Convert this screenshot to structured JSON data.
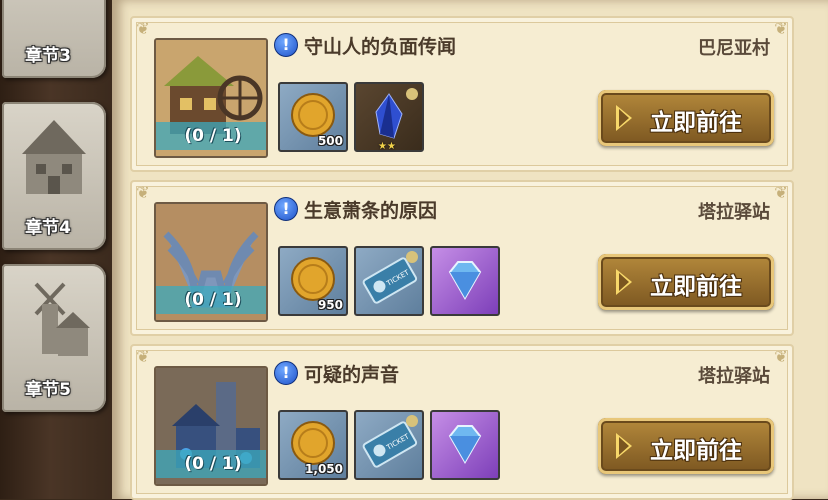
{
  "chapters": [
    {
      "label": "章节3"
    },
    {
      "label": "章节4"
    },
    {
      "label": "章节5"
    }
  ],
  "quests": [
    {
      "title": "守山人的负面传闻",
      "location": "巴尼亚村",
      "progress": "(0 / 1)",
      "alert_mark": "!",
      "button_label": "立即前往",
      "rewards": [
        {
          "type": "gold-coin",
          "qty": "500"
        },
        {
          "type": "blue-crystal",
          "qty": "",
          "stars": "★★"
        }
      ]
    },
    {
      "title": "生意萧条的原因",
      "location": "塔拉驿站",
      "progress": "(0 / 1)",
      "alert_mark": "!",
      "button_label": "立即前往",
      "rewards": [
        {
          "type": "gold-coin",
          "qty": "950"
        },
        {
          "type": "ticket",
          "qty": "",
          "text": "TICKET"
        },
        {
          "type": "diamond",
          "qty": ""
        }
      ]
    },
    {
      "title": "可疑的声音",
      "location": "塔拉驿站",
      "progress": "(0 / 1)",
      "alert_mark": "!",
      "button_label": "立即前往",
      "rewards": [
        {
          "type": "gold-coin",
          "qty": "1,050"
        },
        {
          "type": "ticket",
          "qty": "",
          "text": "TICKET"
        },
        {
          "type": "diamond",
          "qty": ""
        }
      ]
    }
  ],
  "colors": {
    "parchment": "#f6edd2",
    "button_gold": "#b58a3c",
    "progress_teal": "#3caabe",
    "alert_blue": "#1f52c9"
  }
}
